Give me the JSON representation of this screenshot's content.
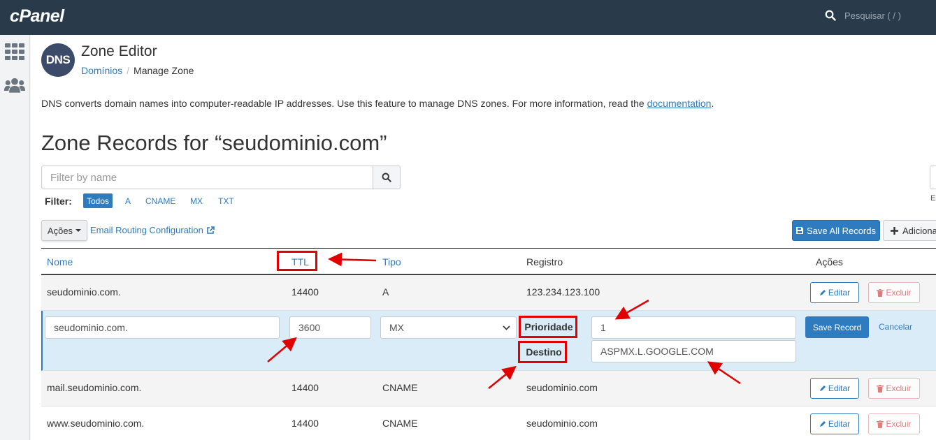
{
  "header": {
    "logo": "cPanel",
    "search_placeholder": "Pesquisar ( / )"
  },
  "sidebar": {
    "items": [
      {
        "icon": "grid-icon"
      },
      {
        "icon": "users-icon"
      }
    ]
  },
  "page": {
    "icon_text": "DNS",
    "title": "Zone Editor",
    "breadcrumb": {
      "parent": "Domínios",
      "separator": "/",
      "current": "Manage Zone"
    },
    "description": "DNS converts domain names into computer-readable IP addresses. Use this feature to manage DNS zones. For more information, read the ",
    "doc_link": "documentation",
    "description_end": ".",
    "heading": "Zone Records for “seudominio.com”"
  },
  "filter": {
    "placeholder": "Filter by name",
    "label": "Filter:",
    "options": [
      "Todos",
      "A",
      "CNAME",
      "MX",
      "TXT"
    ],
    "active": "Todos"
  },
  "right_cut_text": "Es",
  "toolbar": {
    "acoes": "Ações",
    "email_routing": "Email Routing Configuration",
    "save_all": "Save All Records",
    "adicionar": "Adiciona"
  },
  "table": {
    "headers": {
      "nome": "Nome",
      "ttl": "TTL",
      "tipo": "Tipo",
      "registro": "Registro",
      "acoes": "Ações"
    },
    "rows": [
      {
        "nome": "seudominio.com.",
        "ttl": "14400",
        "tipo": "A",
        "registro": "123.234.123.100",
        "edit": "Editar",
        "delete": "Excluir"
      },
      {
        "nome": "mail.seudominio.com.",
        "ttl": "14400",
        "tipo": "CNAME",
        "registro": "seudominio.com",
        "edit": "Editar",
        "delete": "Excluir"
      },
      {
        "nome": "www.seudominio.com.",
        "ttl": "14400",
        "tipo": "CNAME",
        "registro": "seudominio.com",
        "edit": "Editar",
        "delete": "Excluir"
      }
    ],
    "edit_row": {
      "nome": "seudominio.com.",
      "ttl": "3600",
      "tipo": "MX",
      "prioridade_label": "Prioridade",
      "prioridade": "1",
      "destino_label": "Destino",
      "destino": "ASPMX.L.GOOGLE.COM",
      "save": "Save Record",
      "cancel": "Cancelar"
    }
  },
  "colors": {
    "topbar": "#293a4a",
    "link": "#2f7bbf",
    "annotation": "#e00000",
    "edit_row_bg": "#d9ecf8"
  }
}
